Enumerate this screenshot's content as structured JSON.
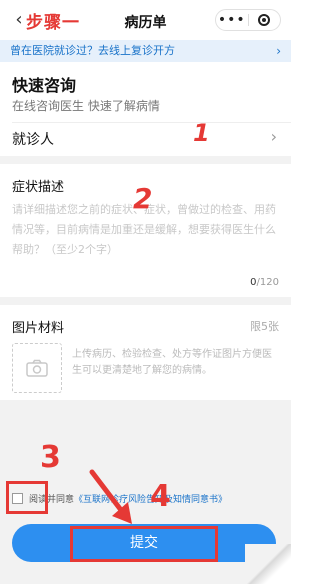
{
  "nav": {
    "back_icon": "back-chevron-icon",
    "step_text": "步骤一",
    "title": "病历单",
    "more_icon": "more-dots-icon",
    "target_icon": "target-icon"
  },
  "banner": {
    "text": "曾在医院就诊过？去线上复诊开方",
    "arrow": "›"
  },
  "quick": {
    "title": "快速咨询",
    "subtitle": "在线咨询医生 快速了解病情",
    "patient_label": "就诊人",
    "chevron": "›"
  },
  "symptom": {
    "title": "症状描述",
    "placeholder": "请详细描述您之前的症状、症状，曾做过的检查、用药情况等，目前病情是加重还是缓解，想要获得医生什么帮助？（至少2个字）",
    "count_current": "0",
    "count_max": "/120"
  },
  "images": {
    "title": "图片材料",
    "limit": "限5张",
    "camera_icon": "camera-icon",
    "hint": "上传病历、检验检查、处方等作证图片方便医生可以更清楚地了解您的病情。"
  },
  "agreement": {
    "prefix": "阅读并同意",
    "link": "《互联网诊疗风险告知及知情同意书》"
  },
  "submit": {
    "label": "提交"
  },
  "annotations": {
    "mark1": "1",
    "mark2": "2",
    "mark3": "3",
    "mark4": "4",
    "color": "#e53935"
  },
  "colors": {
    "accent": "#2d8ff0",
    "link": "#1a73c9",
    "banner_bg": "#e6f0fb"
  }
}
